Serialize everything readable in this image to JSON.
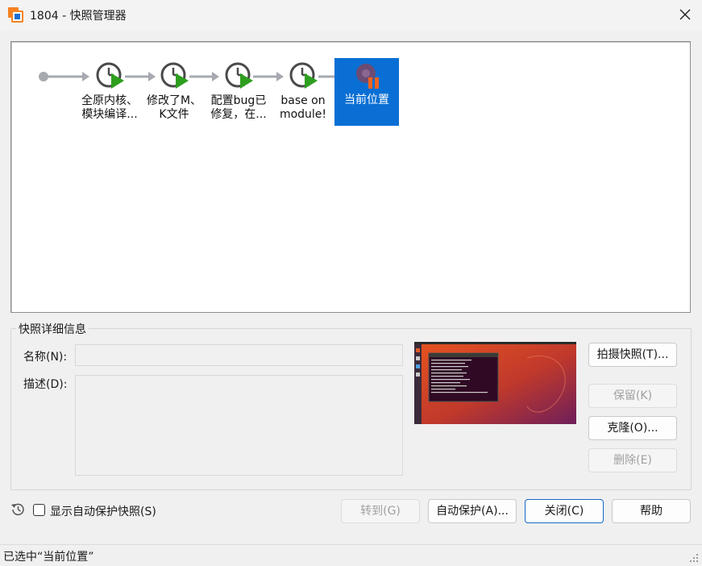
{
  "window": {
    "title": "1804 - 快照管理器",
    "close_icon": "close-icon"
  },
  "timeline": {
    "snapshots": [
      {
        "line1": "全原内核、",
        "line2": "模块编译..."
      },
      {
        "line1": "修改了M、",
        "line2": "K文件"
      },
      {
        "line1": "配置bug已",
        "line2": "修复，在..."
      },
      {
        "line1": "base on",
        "line2": "module!"
      }
    ],
    "current": {
      "label": "当前位置",
      "selected": true
    }
  },
  "details": {
    "group_title": "快照详细信息",
    "name_label": "名称(N):",
    "name_value": "",
    "desc_label": "描述(D):",
    "desc_value": ""
  },
  "buttons": {
    "take_snapshot": "拍摄快照(T)...",
    "keep": "保留(K)",
    "clone": "克隆(O)...",
    "delete": "删除(E)",
    "goto": "转到(G)",
    "autoprotect": "自动保护(A)...",
    "close": "关闭(C)",
    "help": "帮助"
  },
  "footer": {
    "show_autoprotect_label": "显示自动保护快照(S)",
    "show_autoprotect_checked": false
  },
  "status": {
    "text": "已选中“当前位置”"
  }
}
